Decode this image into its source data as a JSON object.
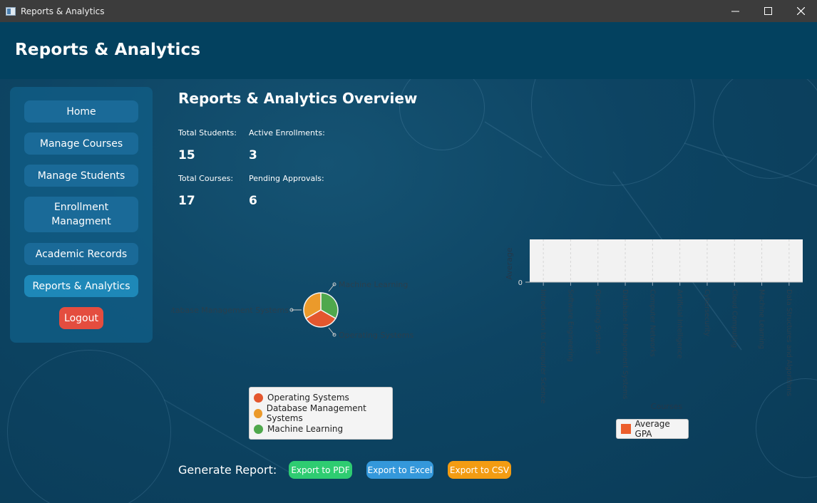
{
  "window": {
    "title": "Reports & Analytics"
  },
  "header": {
    "title": "Reports & Analytics"
  },
  "sidebar": {
    "items": [
      {
        "label": "Home"
      },
      {
        "label": "Manage Courses"
      },
      {
        "label": "Manage Students"
      },
      {
        "label": "Enrollment\nManagment"
      },
      {
        "label": "Academic Records"
      },
      {
        "label": "Reports & Analytics"
      }
    ],
    "logout": "Logout"
  },
  "overview": {
    "title": "Reports & Analytics Overview",
    "total_students_label": "Total Students:",
    "total_students": "15",
    "active_enrollments_label": "Active Enrollments:",
    "active_enrollments": "3",
    "total_courses_label": "Total Courses:",
    "total_courses": "17",
    "pending_approvals_label": "Pending Approvals:",
    "pending_approvals": "6"
  },
  "pie_chart": {
    "slice_labels": [
      "Machine Learning",
      "Database Management Systems",
      "Operating Systems"
    ],
    "legend": [
      "Operating Systems",
      "Database Management Systems",
      "Machine Learning"
    ]
  },
  "chart_data": [
    {
      "type": "pie",
      "slices": [
        {
          "name": "Operating Systems",
          "value": 1,
          "color": "#e4572e"
        },
        {
          "name": "Database Management Systems",
          "value": 1,
          "color": "#eb9a2b"
        },
        {
          "name": "Machine Learning",
          "value": 1,
          "color": "#4fa84c"
        }
      ]
    },
    {
      "type": "bar",
      "categories": [
        "Introduction to Computer Science",
        "Software Engineering",
        "Operating Systems",
        "Database Management Systems",
        "Computer Networks",
        "Artificial Intelligence",
        "Cybersecurity",
        "Cloud Computing",
        "Machine Learning",
        "Data Structures and Algorithms"
      ],
      "series": [
        {
          "name": "Average GPA",
          "values": [
            0,
            0,
            0,
            0,
            0,
            0,
            0,
            0,
            0,
            0
          ]
        }
      ],
      "xlabel": "Courses",
      "ylabel": "Average",
      "y_tick": "0",
      "color": "#ec5e2c"
    }
  ],
  "footer": {
    "generate_label": "Generate Report:",
    "pdf": "Export to PDF",
    "excel": "Export to Excel",
    "csv": "Export to CSV"
  },
  "colors": {
    "pdf": "#2ecc71",
    "excel": "#3498db",
    "csv": "#f39c12"
  }
}
